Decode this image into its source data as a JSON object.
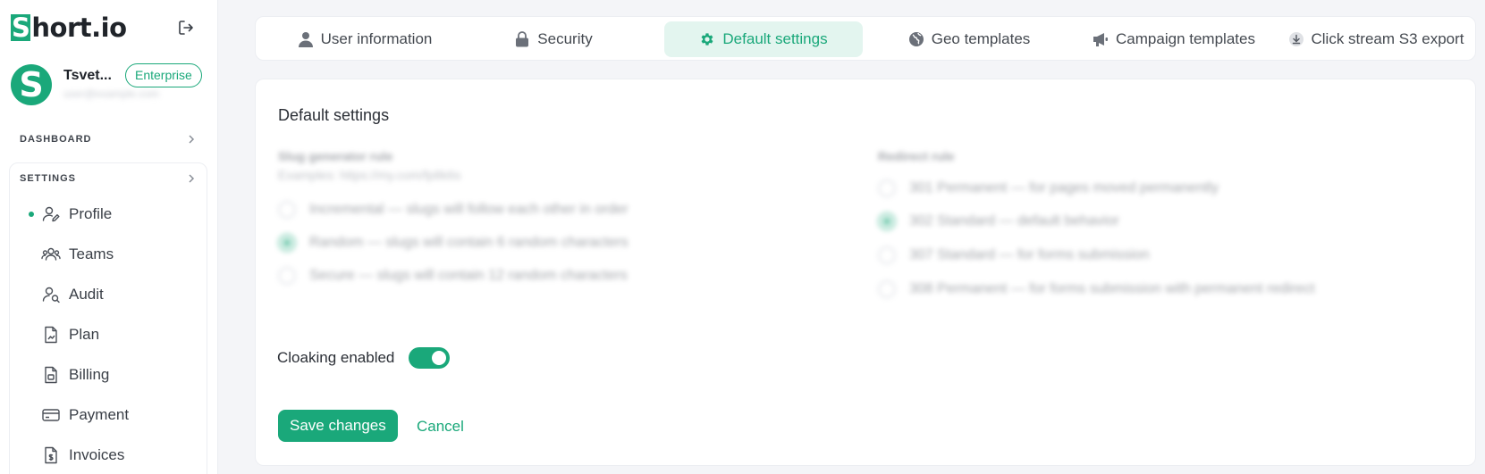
{
  "app": {
    "logo_mark": "S",
    "logo_rest": "hort.io"
  },
  "account": {
    "avatar_letter": "S",
    "name": "Tsvet...",
    "plan_badge": "Enterprise",
    "email": "user@example.com"
  },
  "sidebar": {
    "dashboard_label": "DASHBOARD",
    "settings_label": "SETTINGS",
    "items": [
      {
        "label": "Profile",
        "icon": "user-edit-icon",
        "active": true
      },
      {
        "label": "Teams",
        "icon": "users-icon"
      },
      {
        "label": "Audit",
        "icon": "user-search-icon"
      },
      {
        "label": "Plan",
        "icon": "document-chart-icon"
      },
      {
        "label": "Billing",
        "icon": "document-lines-icon"
      },
      {
        "label": "Payment",
        "icon": "credit-card-icon"
      },
      {
        "label": "Invoices",
        "icon": "invoice-icon"
      }
    ]
  },
  "tabs": [
    {
      "label": "User information",
      "icon": "user-icon"
    },
    {
      "label": "Security",
      "icon": "lock-icon"
    },
    {
      "label": "Default settings",
      "icon": "gear-icon",
      "active": true
    },
    {
      "label": "Geo templates",
      "icon": "globe-icon"
    },
    {
      "label": "Campaign templates",
      "icon": "megaphone-icon"
    },
    {
      "label": "Click stream S3 export",
      "icon": "download-icon"
    }
  ],
  "main": {
    "title": "Default settings",
    "slug": {
      "label": "Slug generator rule",
      "hint": "Examples: https://my.com/fp8k6s",
      "options": [
        "Incremental — slugs will follow each other in order",
        "Random — slugs will contain 6 random characters",
        "Secure — slugs will contain 12 random characters"
      ],
      "selected_index": 1
    },
    "redirect": {
      "label": "Redirect rule",
      "options": [
        "301 Permanent — for pages moved permanently",
        "302 Standard — default behavior",
        "307 Standard — for forms submission",
        "308 Permanent — for forms submission with permanent redirect"
      ],
      "selected_index": 1
    },
    "cloaking_label": "Cloaking enabled",
    "cloaking_enabled": true,
    "save_label": "Save changes",
    "cancel_label": "Cancel"
  },
  "colors": {
    "accent": "#1aa87a",
    "accent_light": "#e3f5ef",
    "background": "#f4f5f8"
  }
}
